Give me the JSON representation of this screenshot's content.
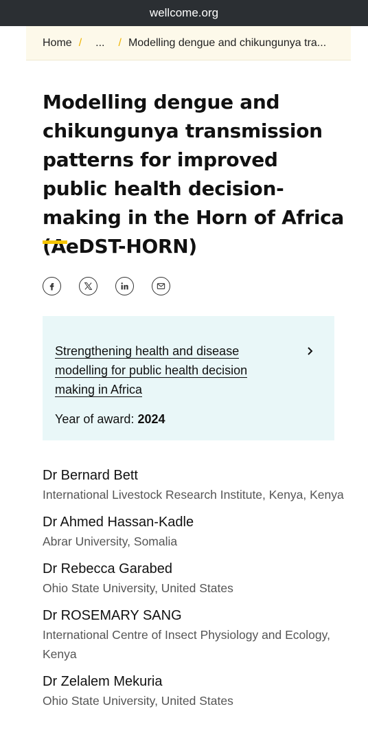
{
  "browser": {
    "url": "wellcome.org"
  },
  "breadcrumb": {
    "home": "Home",
    "separator": "/",
    "ellipsis": "...",
    "current": "Modelling dengue and chikungunya tra..."
  },
  "page": {
    "title": "Modelling dengue and chikungunya transmission patterns for improved public health decision-making in the Horn of Africa (AeDST-HORN)"
  },
  "share": {
    "icons": [
      "facebook-icon",
      "x-icon",
      "linkedin-icon",
      "email-icon"
    ]
  },
  "award": {
    "scheme_link": "Strengthening health and disease modelling for public health decision making in Africa",
    "year_label": "Year of award:",
    "year_value": "2024"
  },
  "people": [
    {
      "name": "Dr Bernard Bett",
      "org": "International Livestock Research Institute, Kenya, Kenya"
    },
    {
      "name": "Dr Ahmed Hassan-Kadle",
      "org": "Abrar University, Somalia"
    },
    {
      "name": "Dr Rebecca Garabed",
      "org": "Ohio State University, United States"
    },
    {
      "name": "Dr ROSEMARY SANG",
      "org": "International Centre of Insect Physiology and Ecology, Kenya"
    },
    {
      "name": "Dr Zelalem Mekuria",
      "org": "Ohio State University, United States"
    }
  ],
  "colors": {
    "accent_yellow": "#f5c400",
    "breadcrumb_bg": "#fdf9ea",
    "award_bg": "#e9f7f8",
    "url_bar_bg": "#2b2f33"
  }
}
